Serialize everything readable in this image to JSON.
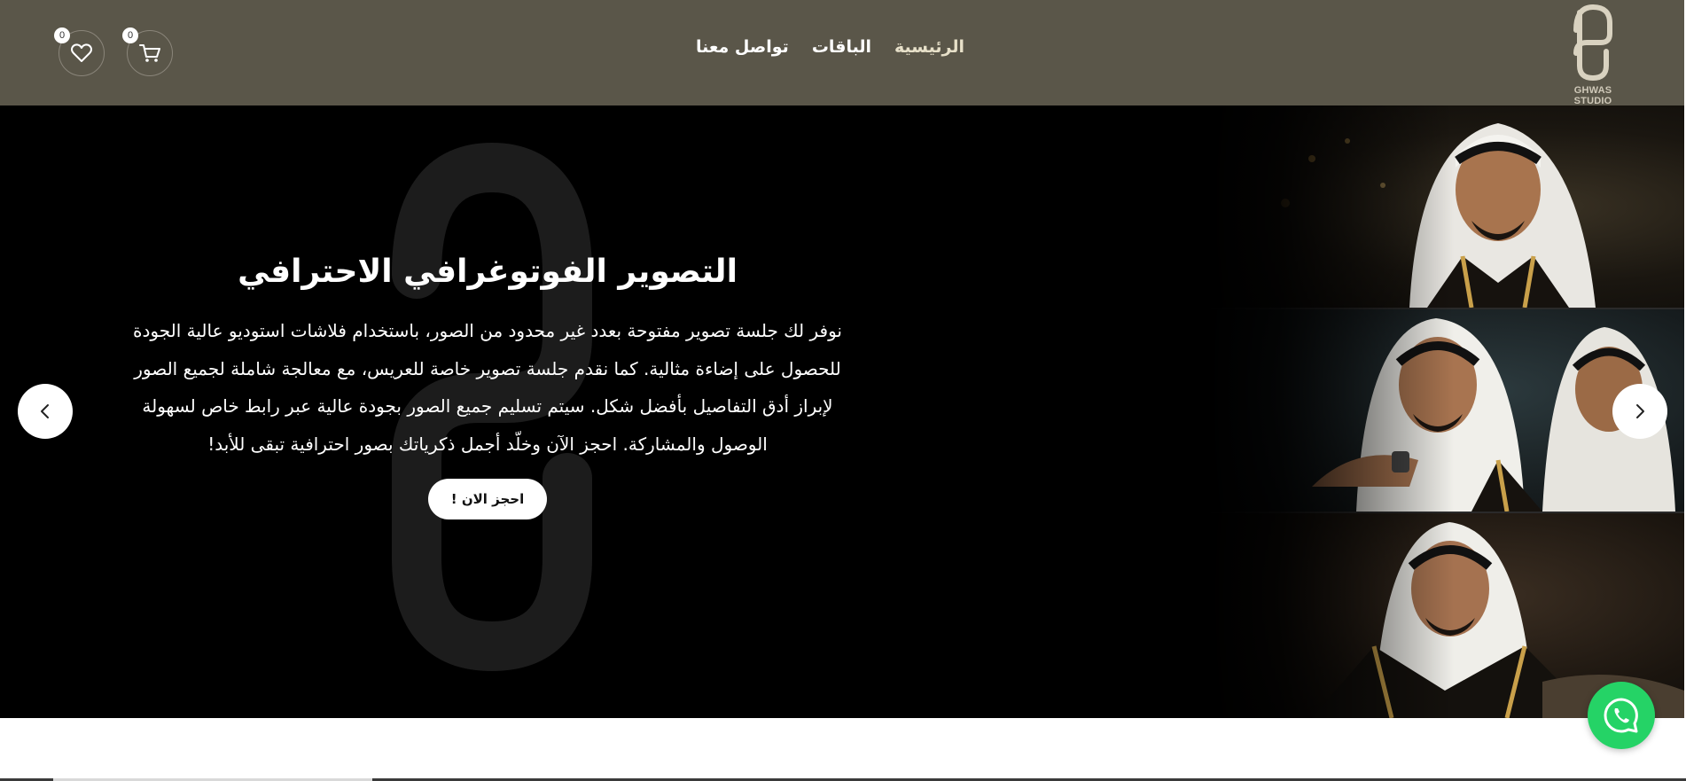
{
  "brand": {
    "logo_caption": "GHWAS STUDIO",
    "header_color": "#5a5649"
  },
  "nav": {
    "items": [
      {
        "label": "الرئيسية",
        "active": true
      },
      {
        "label": "الباقات",
        "active": false
      },
      {
        "label": "تواصل معنا",
        "active": false
      }
    ]
  },
  "header_actions": {
    "cart": {
      "icon": "cart-icon",
      "count": "0"
    },
    "wishlist": {
      "icon": "heart-icon",
      "count": "0"
    }
  },
  "hero": {
    "title": "التصوير الفوتوغرافي الاحترافي",
    "description": "نوفر لك جلسة تصوير مفتوحة بعدد غير محدود من الصور، باستخدام فلاشات استوديو عالية الجودة للحصول على إضاءة مثالية. كما نقدم جلسة تصوير خاصة للعريس، مع معالجة شاملة لجميع الصور لإبراز أدق التفاصيل بأفضل شكل. سيتم تسليم جميع الصور بجودة عالية عبر رابط خاص لسهولة الوصول والمشاركة. احجز الآن وخلّد أجمل ذكرياتك بصور احترافية تبقى للأبد!",
    "cta_label": "احجز الان !",
    "prev_icon": "chevron-left-icon",
    "next_icon": "chevron-right-icon"
  },
  "floating": {
    "whatsapp_icon": "whatsapp-icon",
    "whatsapp_color": "#25d366"
  }
}
